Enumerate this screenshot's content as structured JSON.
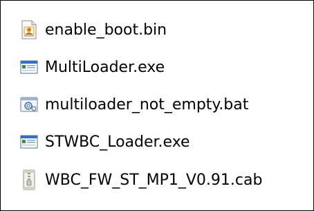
{
  "files": [
    {
      "name": "enable_boot.bin",
      "icon": "binary-file-icon"
    },
    {
      "name": "MultiLoader.exe",
      "icon": "application-icon"
    },
    {
      "name": "multiloader_not_empty.bat",
      "icon": "batch-file-icon"
    },
    {
      "name": "STWBC_Loader.exe",
      "icon": "application-icon"
    },
    {
      "name": "WBC_FW_ST_MP1_V0.91.cab",
      "icon": "cabinet-archive-icon"
    }
  ],
  "colors": {
    "border": "#000000",
    "background": "#ffffff",
    "app_window_blue": "#2f6fc4",
    "app_window_green": "#3f8f3a"
  }
}
